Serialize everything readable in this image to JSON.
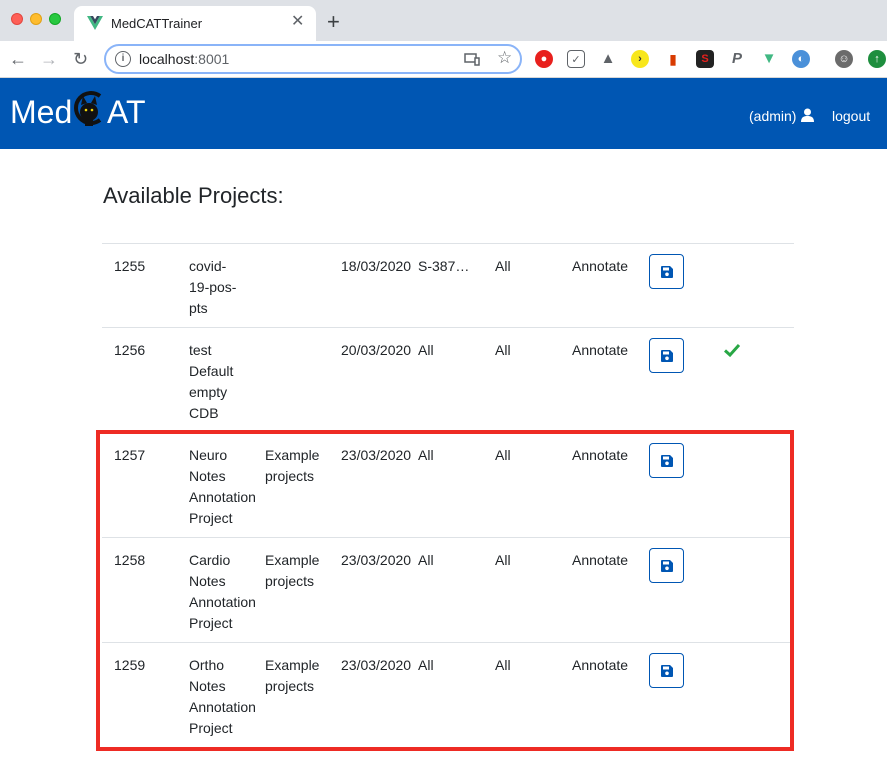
{
  "browser": {
    "tab_title": "MedCATTrainer",
    "tab_close": "✕",
    "new_tab": "+",
    "url_host": "localhost",
    "url_port": ":8001"
  },
  "navbar": {
    "logo_left": "Med",
    "logo_right": "AT",
    "user_label": "(admin)",
    "logout_label": "logout"
  },
  "page": {
    "heading": "Available Projects:"
  },
  "projects": [
    {
      "id": "1255",
      "name": "covid-\n19-pos-\npts",
      "description": "",
      "date": "18/03/2020",
      "cdb": "S-387…",
      "vocab": "All",
      "action": "Annotate",
      "complete": false
    },
    {
      "id": "1256",
      "name": "test\nDefault\nempty\nCDB",
      "description": "",
      "date": "20/03/2020",
      "cdb": "All",
      "vocab": "All",
      "action": "Annotate",
      "complete": true
    },
    {
      "id": "1257",
      "name": "Neuro\nNotes\nAnnotation\nProject",
      "description": "Example\nprojects",
      "date": "23/03/2020",
      "cdb": "All",
      "vocab": "All",
      "action": "Annotate",
      "complete": false
    },
    {
      "id": "1258",
      "name": "Cardio\nNotes\nAnnotation\nProject",
      "description": "Example\nprojects",
      "date": "23/03/2020",
      "cdb": "All",
      "vocab": "All",
      "action": "Annotate",
      "complete": false
    },
    {
      "id": "1259",
      "name": "Ortho\nNotes\nAnnotation\nProject",
      "description": "Example\nprojects",
      "date": "23/03/2020",
      "cdb": "All",
      "vocab": "All",
      "action": "Annotate",
      "complete": false
    }
  ],
  "colors": {
    "navbar": "#0056b3",
    "highlight": "#ee2b24",
    "check": "#28a745"
  }
}
